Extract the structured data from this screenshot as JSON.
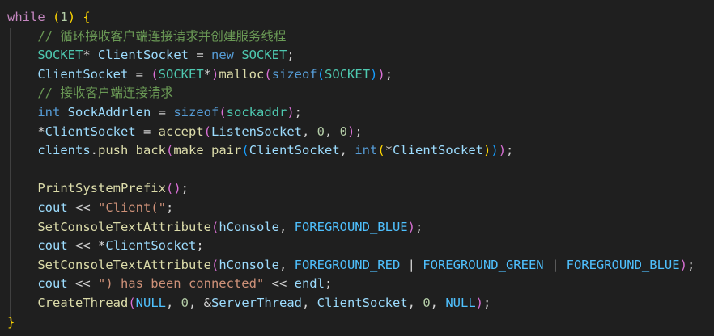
{
  "lines": [
    [
      [
        "while",
        "ctrl"
      ],
      [
        " ",
        "op"
      ],
      [
        "(",
        "br1"
      ],
      [
        "1",
        "num"
      ],
      [
        ")",
        "br1"
      ],
      [
        " ",
        "op"
      ],
      [
        "{",
        "br1"
      ]
    ],
    [
      [
        "    ",
        "op"
      ],
      [
        "// 循环接收客户端连接请求并创建服务线程",
        "cmt"
      ]
    ],
    [
      [
        "    ",
        "op"
      ],
      [
        "SOCKET",
        "type"
      ],
      [
        "* ",
        "op"
      ],
      [
        "ClientSocket",
        "var"
      ],
      [
        " = ",
        "op"
      ],
      [
        "new",
        "kw"
      ],
      [
        " ",
        "op"
      ],
      [
        "SOCKET",
        "type"
      ],
      [
        ";",
        "op"
      ]
    ],
    [
      [
        "    ",
        "op"
      ],
      [
        "ClientSocket",
        "var"
      ],
      [
        " = ",
        "op"
      ],
      [
        "(",
        "br2"
      ],
      [
        "SOCKET",
        "type"
      ],
      [
        "*",
        "op"
      ],
      [
        ")",
        "br2"
      ],
      [
        "malloc",
        "fn"
      ],
      [
        "(",
        "br2"
      ],
      [
        "sizeof",
        "kw"
      ],
      [
        "(",
        "br3"
      ],
      [
        "SOCKET",
        "type"
      ],
      [
        ")",
        "br3"
      ],
      [
        ")",
        "br2"
      ],
      [
        ";",
        "op"
      ]
    ],
    [
      [
        "    ",
        "op"
      ],
      [
        "// 接收客户端连接请求",
        "cmt"
      ]
    ],
    [
      [
        "    ",
        "op"
      ],
      [
        "int",
        "kw"
      ],
      [
        " ",
        "op"
      ],
      [
        "SockAddrlen",
        "var"
      ],
      [
        " = ",
        "op"
      ],
      [
        "sizeof",
        "kw"
      ],
      [
        "(",
        "br2"
      ],
      [
        "sockaddr",
        "type"
      ],
      [
        ")",
        "br2"
      ],
      [
        ";",
        "op"
      ]
    ],
    [
      [
        "    ",
        "op"
      ],
      [
        "*",
        "op"
      ],
      [
        "ClientSocket",
        "var"
      ],
      [
        " = ",
        "op"
      ],
      [
        "accept",
        "fn"
      ],
      [
        "(",
        "br2"
      ],
      [
        "ListenSocket",
        "var"
      ],
      [
        ", ",
        "op"
      ],
      [
        "0",
        "num"
      ],
      [
        ", ",
        "op"
      ],
      [
        "0",
        "num"
      ],
      [
        ")",
        "br2"
      ],
      [
        ";",
        "op"
      ]
    ],
    [
      [
        "    ",
        "op"
      ],
      [
        "clients",
        "var"
      ],
      [
        ".",
        "op"
      ],
      [
        "push_back",
        "fn"
      ],
      [
        "(",
        "br2"
      ],
      [
        "make_pair",
        "fn"
      ],
      [
        "(",
        "br3"
      ],
      [
        "ClientSocket",
        "var"
      ],
      [
        ", ",
        "op"
      ],
      [
        "int",
        "kw"
      ],
      [
        "(",
        "br1"
      ],
      [
        "*",
        "op"
      ],
      [
        "ClientSocket",
        "var"
      ],
      [
        ")",
        "br1"
      ],
      [
        ")",
        "br3"
      ],
      [
        ")",
        "br2"
      ],
      [
        ";",
        "op"
      ]
    ],
    [
      [
        "",
        "op"
      ]
    ],
    [
      [
        "    ",
        "op"
      ],
      [
        "PrintSystemPrefix",
        "fn"
      ],
      [
        "(",
        "br2"
      ],
      [
        ")",
        "br2"
      ],
      [
        ";",
        "op"
      ]
    ],
    [
      [
        "    ",
        "op"
      ],
      [
        "cout",
        "var"
      ],
      [
        " << ",
        "op"
      ],
      [
        "\"Client(\"",
        "str"
      ],
      [
        ";",
        "op"
      ]
    ],
    [
      [
        "    ",
        "op"
      ],
      [
        "SetConsoleTextAttribute",
        "fn"
      ],
      [
        "(",
        "br2"
      ],
      [
        "hConsole",
        "var"
      ],
      [
        ", ",
        "op"
      ],
      [
        "FOREGROUND_BLUE",
        "enum"
      ],
      [
        ")",
        "br2"
      ],
      [
        ";",
        "op"
      ]
    ],
    [
      [
        "    ",
        "op"
      ],
      [
        "cout",
        "var"
      ],
      [
        " << ",
        "op"
      ],
      [
        "*",
        "op"
      ],
      [
        "ClientSocket",
        "var"
      ],
      [
        ";",
        "op"
      ]
    ],
    [
      [
        "    ",
        "op"
      ],
      [
        "SetConsoleTextAttribute",
        "fn"
      ],
      [
        "(",
        "br2"
      ],
      [
        "hConsole",
        "var"
      ],
      [
        ", ",
        "op"
      ],
      [
        "FOREGROUND_RED",
        "enum"
      ],
      [
        " | ",
        "op"
      ],
      [
        "FOREGROUND_GREEN",
        "enum"
      ],
      [
        " | ",
        "op"
      ],
      [
        "FOREGROUND_BLUE",
        "enum"
      ],
      [
        ")",
        "br2"
      ],
      [
        ";",
        "op"
      ]
    ],
    [
      [
        "    ",
        "op"
      ],
      [
        "cout",
        "var"
      ],
      [
        " << ",
        "op"
      ],
      [
        "\") has been connected\"",
        "str"
      ],
      [
        " << ",
        "op"
      ],
      [
        "endl",
        "var"
      ],
      [
        ";",
        "op"
      ]
    ],
    [
      [
        "    ",
        "op"
      ],
      [
        "CreateThread",
        "fn"
      ],
      [
        "(",
        "br2"
      ],
      [
        "NULL",
        "enum"
      ],
      [
        ", ",
        "op"
      ],
      [
        "0",
        "num"
      ],
      [
        ", ",
        "op"
      ],
      [
        "&",
        "op"
      ],
      [
        "ServerThread",
        "var"
      ],
      [
        ", ",
        "op"
      ],
      [
        "ClientSocket",
        "var"
      ],
      [
        ", ",
        "op"
      ],
      [
        "0",
        "num"
      ],
      [
        ", ",
        "op"
      ],
      [
        "NULL",
        "enum"
      ],
      [
        ")",
        "br2"
      ],
      [
        ";",
        "op"
      ]
    ],
    [
      [
        "}",
        "br1"
      ]
    ]
  ],
  "colors": {
    "background": "#1f1f1f",
    "comment": "#6a9955",
    "keyword": "#569cd6",
    "control": "#c586c0",
    "type": "#4ec9b0",
    "function": "#dcdcaa",
    "variable": "#9cdcfe",
    "constant": "#4fc1ff",
    "string": "#ce9178",
    "number": "#b5cea8",
    "bracket1": "#ffd700",
    "bracket2": "#da70d6",
    "bracket3": "#179fff"
  }
}
